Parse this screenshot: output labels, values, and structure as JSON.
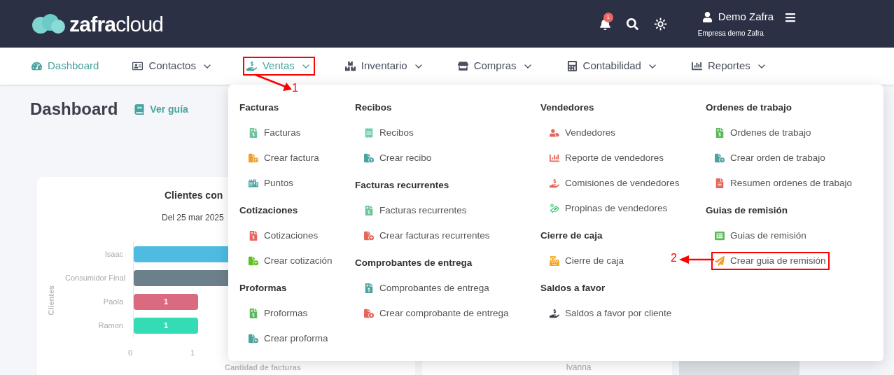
{
  "header": {
    "logo": "**zafra**cloud",
    "notifications": "1",
    "user_name": "Demo Zafra",
    "company": "Empresa demo Zafra"
  },
  "nav": [
    {
      "label": "Dashboard",
      "active": true,
      "dropdown": false,
      "annotated": false
    },
    {
      "label": "Contactos",
      "active": false,
      "dropdown": true,
      "annotated": false
    },
    {
      "label": "Ventas",
      "active": true,
      "dropdown": true,
      "annotated": true
    },
    {
      "label": "Inventario",
      "active": false,
      "dropdown": true,
      "annotated": false
    },
    {
      "label": "Compras",
      "active": false,
      "dropdown": true,
      "annotated": false
    },
    {
      "label": "Contabilidad",
      "active": false,
      "dropdown": true,
      "annotated": false
    },
    {
      "label": "Reportes",
      "active": false,
      "dropdown": true,
      "annotated": false
    }
  ],
  "page": {
    "title": "Dashboard",
    "guide_link": "Ver guía"
  },
  "chart_card": {
    "title": "Clientes con",
    "subtitle": "Del 25 mar 2025",
    "ylabel": "Clientes",
    "xlabel": "Cantidad de facturas",
    "xticks": [
      "0",
      "1"
    ],
    "bars": [
      {
        "label": "Isaac",
        "color": "#4fbbe3"
      },
      {
        "label": "Consumidor Final",
        "color": "#6c808b"
      },
      {
        "label": "Paola",
        "color": "#d96a80",
        "value_label": "1"
      },
      {
        "label": "Ramon",
        "color": "#34dcb6",
        "value_label": "1"
      }
    ]
  },
  "second_card": {
    "text": "Ivanna"
  },
  "dropdown": {
    "columns": [
      {
        "sections": [
          {
            "heading": "Facturas",
            "items": [
              {
                "label": "Facturas",
                "annotated": false
              },
              {
                "label": "Crear factura",
                "annotated": false
              },
              {
                "label": "Puntos",
                "annotated": false
              }
            ]
          },
          {
            "heading": "Cotizaciones",
            "items": [
              {
                "label": "Cotizaciones",
                "annotated": false
              },
              {
                "label": "Crear cotización",
                "annotated": false
              }
            ]
          },
          {
            "heading": "Proformas",
            "items": [
              {
                "label": "Proformas",
                "annotated": false
              },
              {
                "label": "Crear proforma",
                "annotated": false
              }
            ]
          }
        ]
      },
      {
        "sections": [
          {
            "heading": "Recibos",
            "items": [
              {
                "label": "Recibos",
                "annotated": false
              },
              {
                "label": "Crear recibo",
                "annotated": false
              }
            ]
          },
          {
            "heading": "Facturas recurrentes",
            "items": [
              {
                "label": "Facturas recurrentes",
                "annotated": false
              },
              {
                "label": "Crear facturas recurrentes",
                "annotated": false
              }
            ]
          },
          {
            "heading": "Comprobantes de entrega",
            "items": [
              {
                "label": "Comprobantes de entrega",
                "annotated": false
              },
              {
                "label": "Crear comprobante de entrega",
                "annotated": false
              }
            ]
          }
        ]
      },
      {
        "sections": [
          {
            "heading": "Vendedores",
            "items": [
              {
                "label": "Vendedores",
                "annotated": false
              },
              {
                "label": "Reporte de vendedores",
                "annotated": false
              },
              {
                "label": "Comisiones de vendedores",
                "annotated": false
              },
              {
                "label": "Propinas de vendedores",
                "annotated": false
              }
            ]
          },
          {
            "heading": "Cierre de caja",
            "items": [
              {
                "label": "Cierre de caja",
                "annotated": false
              }
            ]
          },
          {
            "heading": "Saldos a favor",
            "items": [
              {
                "label": "Saldos a favor por cliente",
                "annotated": false
              }
            ]
          }
        ]
      },
      {
        "sections": [
          {
            "heading": "Ordenes de trabajo",
            "items": [
              {
                "label": "Ordenes de trabajo",
                "annotated": false
              },
              {
                "label": "Crear orden de trabajo",
                "annotated": false
              },
              {
                "label": "Resumen ordenes de trabajo",
                "annotated": false
              }
            ]
          },
          {
            "heading": "Guias de remisión",
            "items": [
              {
                "label": "Guias de remisión",
                "annotated": false
              },
              {
                "label": "Crear guia de remisión",
                "annotated": true
              }
            ]
          }
        ]
      }
    ]
  },
  "annotations": [
    {
      "label": "1"
    },
    {
      "label": "2"
    }
  ]
}
